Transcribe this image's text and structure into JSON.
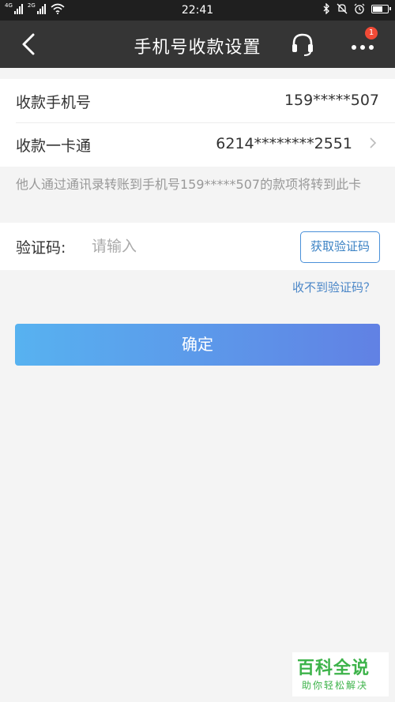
{
  "status_bar": {
    "signal1_tag": "4G",
    "signal2_tag": "2G",
    "time": "22:41"
  },
  "header": {
    "title": "手机号收款设置",
    "badge_count": "1"
  },
  "rows": [
    {
      "label": "收款手机号",
      "value": "159*****507"
    },
    {
      "label": "收款一卡通",
      "value": "6214********2551"
    }
  ],
  "note": "他人通过通讯录转账到手机号159*****507的款项将转到此卡",
  "verify": {
    "label": "验证码:",
    "placeholder": "请输入",
    "get_code_label": "获取验证码",
    "no_code_link": "收不到验证码？"
  },
  "confirm_label": "确定",
  "watermark": {
    "title": "百科全说",
    "subtitle": "助你轻松解决"
  },
  "colors": {
    "navbar_bg": "#353535",
    "accent_blue": "#4a90d9",
    "button_gradient_start": "#57b2f0",
    "button_gradient_end": "#6181e4",
    "badge_red": "#f04a36"
  },
  "icons": [
    "back-arrow-icon",
    "headset-icon",
    "more-dots-icon",
    "chevron-right-icon",
    "bluetooth-icon",
    "bell-off-icon",
    "alarm-icon",
    "battery-icon",
    "wifi-icon",
    "signal-icon"
  ]
}
